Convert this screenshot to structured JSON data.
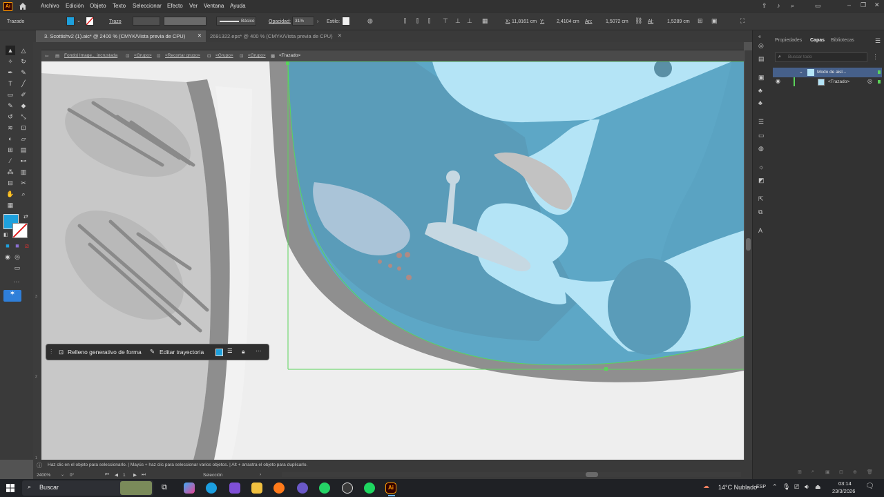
{
  "menubar": {
    "app_logo": "Ai",
    "items": [
      "Archivo",
      "Edición",
      "Objeto",
      "Texto",
      "Seleccionar",
      "Efecto",
      "Ver",
      "Ventana",
      "Ayuda"
    ]
  },
  "control": {
    "selection_label": "Trazado",
    "stroke_label": "Trazo",
    "stroke_style": "Básico",
    "opacity_label": "Opacidad:",
    "opacity_value": "31%",
    "style_label": "Estilo:",
    "x_label": "X:",
    "x_value": "11,8161 cm",
    "y_label": "Y:",
    "y_value": "2,4104 cm",
    "w_label": "An:",
    "w_value": "1,5072 cm",
    "h_label": "Al:",
    "h_value": "1,5289 cm"
  },
  "tabs": [
    {
      "label": "3. Scottishv2 (1).aic* @ 2400 % (CMYK/Vista previa de CPU)",
      "active": true
    },
    {
      "label": "2691322.eps* @ 400 % (CMYK/Vista previa de CPU)",
      "active": false
    }
  ],
  "breadcrumb": [
    "Fondo| Image... incrustada",
    "<Grupo>",
    "<Recortar grupo>",
    "<Grupo>",
    "<Grupo>",
    "<Trazado>"
  ],
  "context_bar": {
    "generative_fill": "Relleno generativo de forma",
    "edit_path": "Editar trayectoria"
  },
  "panels": {
    "tabs": [
      "Propiedades",
      "Capas",
      "Bibliotecas"
    ],
    "active_tab": "Capas",
    "search_placeholder": "Buscar todo",
    "layers": [
      {
        "name": "Modo de aisl...",
        "level": 0
      },
      {
        "name": "<Trazado>",
        "level": 1
      }
    ]
  },
  "status": {
    "hint": "Haz clic en el objeto para seleccionarlo. | Mayús + haz clic para seleccionar varios objetos. | Alt + arrastra el objeto para duplicarlo.",
    "zoom": "2400%",
    "rotation": "0°",
    "page": "1",
    "tool_name": "Selección"
  },
  "ruler_left_labels": [
    "1",
    "2",
    "3"
  ],
  "taskbar": {
    "search_placeholder": "Buscar",
    "weather": "14°C  Nublado",
    "language": "ESP",
    "time": "03:14",
    "date": "23/3/2026"
  },
  "colors": {
    "fill_swatch": "#1ea0dc",
    "ai_orange": "#ff9a00",
    "selection_green": "#5bd45b",
    "accent_blue": "#2f7fd9"
  }
}
